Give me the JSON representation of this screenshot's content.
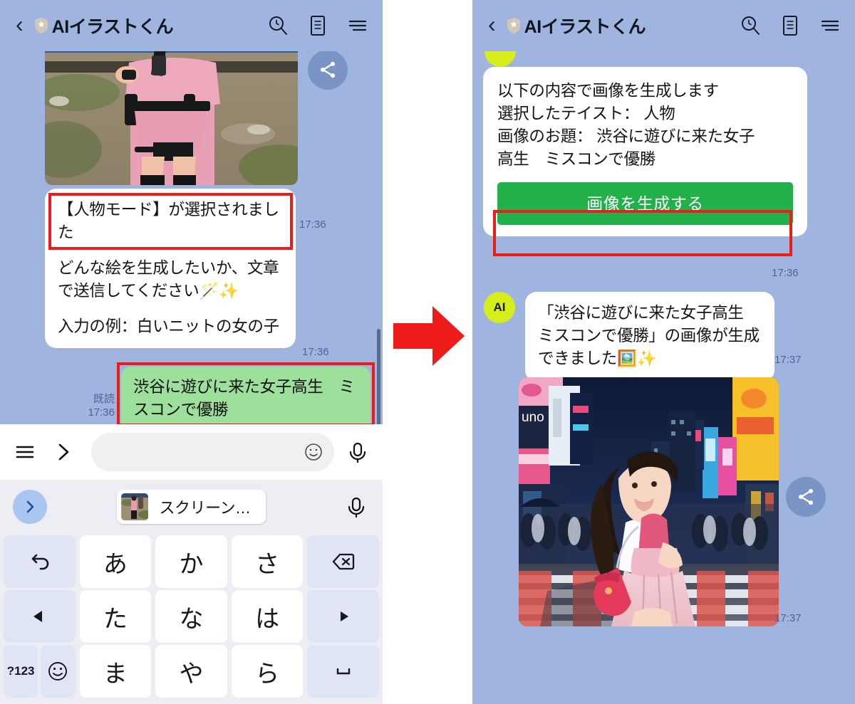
{
  "header": {
    "back_icon": "chevron-left-icon",
    "shield_icon": "verified-shield-icon",
    "title": "AIイラストくん",
    "search_icon": "search-icon",
    "notes_icon": "notes-icon",
    "menu_icon": "hamburger-menu-icon"
  },
  "colors": {
    "chat_background": "#9fb5e0",
    "own_bubble_green": "#9ce09c",
    "other_bubble_white": "#ffffff",
    "highlight_red": "#ee1b1b",
    "generate_button_green": "#22b04a",
    "avatar_yellow": "#d4ed1b",
    "timestamp_blue": "#4f6398",
    "arrow_red": "#ee1b1b"
  },
  "left_panel": {
    "photo_timestamp": "17:36",
    "share_icon": "share-icon",
    "bubble_mode": {
      "line1": "【人物モード】が選択されまし",
      "line2": "た"
    },
    "bubble_instructions": {
      "line1": "どんな絵を生成したいか、文章",
      "line2": "で送信してください",
      "emoji": "🪄✨",
      "line3": "入力の例：白いニットの女の子",
      "timestamp": "17:36"
    },
    "user_message": {
      "line1": "渋谷に遊びに来た女子高生　ミ",
      "line2": "スコンで優勝",
      "read_status": "既読",
      "timestamp": "17:36"
    },
    "input_bar": {
      "menu_icon": "hamburger-menu-icon",
      "expand_icon": "chevron-right-icon",
      "text_field_value": "",
      "text_field_placeholder": "",
      "emoji_icon": "smiley-icon",
      "mic_icon": "microphone-icon"
    },
    "suggestion_bar": {
      "expand_icon": "chevron-right-circle-icon",
      "chip_thumbnail": "screenshot-thumbnail",
      "chip_label": "スクリーン…",
      "mic_icon": "microphone-icon"
    },
    "keyboard": {
      "rows": [
        [
          {
            "label": "",
            "icon": "undo-icon",
            "type": "fn"
          },
          {
            "label": "あ",
            "type": "char"
          },
          {
            "label": "か",
            "type": "char"
          },
          {
            "label": "さ",
            "type": "char"
          },
          {
            "label": "",
            "icon": "backspace-icon",
            "type": "fn"
          }
        ],
        [
          {
            "label": "",
            "icon": "arrow-left-icon",
            "type": "fn"
          },
          {
            "label": "た",
            "type": "char"
          },
          {
            "label": "な",
            "type": "char"
          },
          {
            "label": "は",
            "type": "char"
          },
          {
            "label": "",
            "icon": "arrow-right-icon",
            "type": "fn"
          }
        ],
        [
          {
            "label": "?123",
            "type": "split-123",
            "second": "emoji-icon"
          },
          {
            "label": "ま",
            "type": "char"
          },
          {
            "label": "や",
            "type": "char"
          },
          {
            "label": "ら",
            "type": "char"
          },
          {
            "label": "",
            "icon": "space-icon",
            "type": "fn"
          }
        ]
      ],
      "key_123_label": "?123"
    }
  },
  "arrow": {
    "name": "step-arrow",
    "direction": "right"
  },
  "right_panel": {
    "confirm_bubble": {
      "line1": "以下の内容で画像を生成します",
      "line2": "選択したテイスト：  人物",
      "line3": "画像のお題：  渋谷に遊びに来た女子",
      "line4": "高生　ミスコンで優勝",
      "button_label": "画像を生成する",
      "timestamp": "17:36"
    },
    "ai_reply": {
      "avatar_label": "AI",
      "line1": "「渋谷に遊びに来た女子高生",
      "line2": "ミスコンで優勝」の画像が生成",
      "line3": "できました",
      "emoji": "🖼️✨",
      "timestamp": "17:37"
    },
    "generated_image": {
      "alt": "shibuya-schoolgirl-generated-image",
      "share_icon": "share-icon",
      "timestamp": "17:37"
    }
  }
}
